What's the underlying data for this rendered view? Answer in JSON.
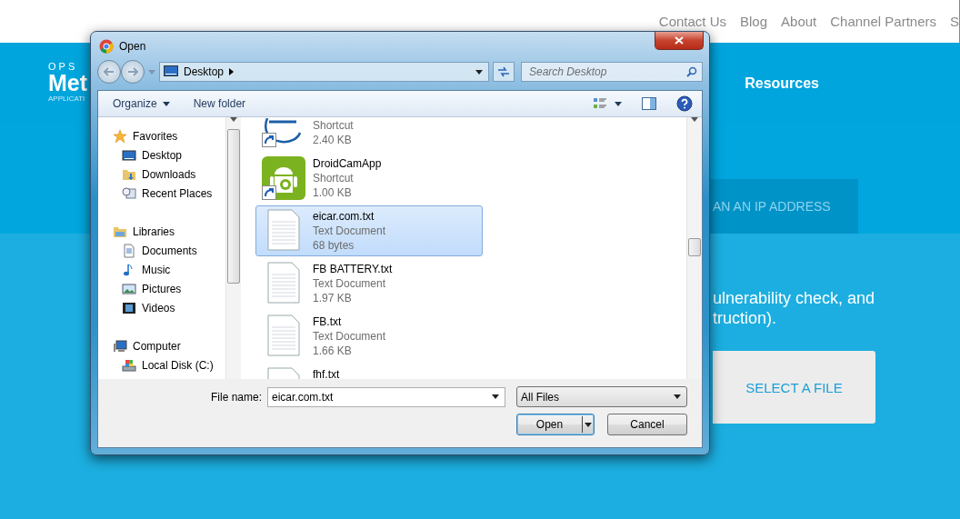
{
  "page": {
    "top_links": [
      "Contact Us",
      "Blog",
      "About",
      "Channel Partners",
      "S"
    ],
    "logo": {
      "line_1": "OPS",
      "line_2": "Met",
      "line_3": "APPLICATI"
    },
    "nav_item": "Resources",
    "tab": "AN AN IP ADDRESS",
    "description": [
      "ulnerability check, and",
      "truction)."
    ],
    "cta": "SELECT A FILE"
  },
  "window": {
    "title": "Open"
  },
  "address": {
    "path": "Desktop"
  },
  "search": {
    "placeholder": "Search Desktop"
  },
  "toolbar": {
    "organize": "Organize",
    "new_folder": "New folder"
  },
  "nav": [
    {
      "label": "Favorites",
      "kind": "favorites",
      "children": [
        {
          "label": "Desktop",
          "kind": "desktop"
        },
        {
          "label": "Downloads",
          "kind": "downloads"
        },
        {
          "label": "Recent Places",
          "kind": "recent"
        }
      ]
    },
    {
      "label": "Libraries",
      "kind": "libraries",
      "children": [
        {
          "label": "Documents",
          "kind": "documents"
        },
        {
          "label": "Music",
          "kind": "music"
        },
        {
          "label": "Pictures",
          "kind": "pictures"
        },
        {
          "label": "Videos",
          "kind": "videos"
        }
      ]
    },
    {
      "label": "Computer",
      "kind": "computer",
      "children": [
        {
          "label": "Local Disk (C:)",
          "kind": "disk"
        }
      ]
    }
  ],
  "files": [
    {
      "kind": "chip_shortcut",
      "lines": [
        "Shortcut",
        "2.40 KB"
      ],
      "selected": false
    },
    {
      "kind": "app_shortcut",
      "name": "DroidCamApp",
      "lines": [
        "Shortcut",
        "1.00 KB"
      ],
      "selected": false
    },
    {
      "kind": "text_document",
      "name": "eicar.com.txt",
      "lines": [
        "Text Document",
        "68 bytes"
      ],
      "selected": true
    },
    {
      "kind": "text_document",
      "name": "FB BATTERY.txt",
      "lines": [
        "Text Document",
        "1.97 KB"
      ],
      "selected": false
    },
    {
      "kind": "text_document",
      "name": "FB.txt",
      "lines": [
        "Text Document",
        "1.66 KB"
      ],
      "selected": false
    },
    {
      "kind": "text_document",
      "name": "fhf.txt",
      "selected": false
    }
  ],
  "footer": {
    "file_name_label": "File name:",
    "file_name": "eicar.com.txt",
    "file_type": "All Files",
    "buttons": [
      "Open",
      "Cancel"
    ]
  }
}
